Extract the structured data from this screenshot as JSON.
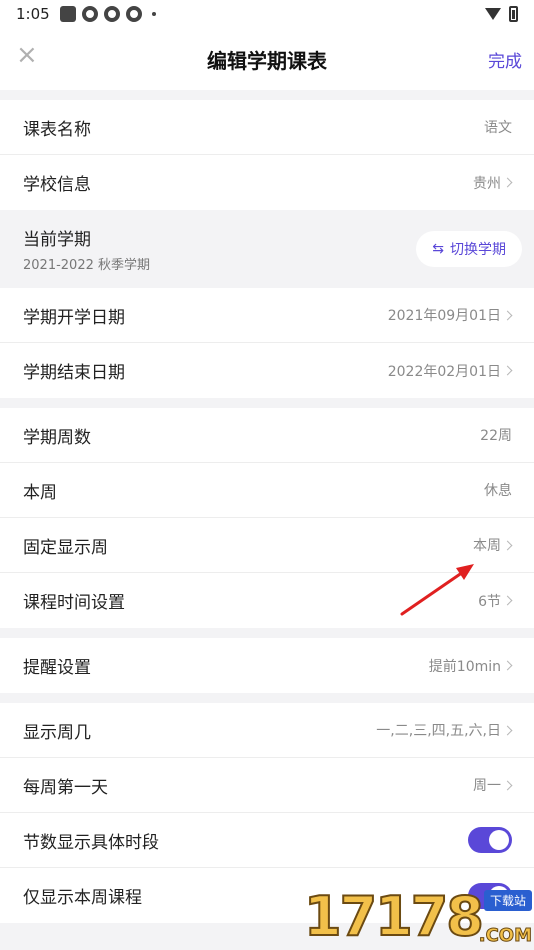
{
  "status_bar": {
    "time": "1:05"
  },
  "header": {
    "title": "编辑学期课表",
    "done_label": "完成"
  },
  "section1": [
    {
      "label": "课表名称",
      "value": "语文",
      "chevron": false
    },
    {
      "label": "学校信息",
      "value": "贵州",
      "chevron": true
    }
  ],
  "term": {
    "label": "当前学期",
    "sub": "2021-2022 秋季学期",
    "switch_label": "切换学期"
  },
  "section2": [
    {
      "label": "学期开学日期",
      "value": "2021年09月01日"
    },
    {
      "label": "学期结束日期",
      "value": "2022年02月01日"
    }
  ],
  "section3": [
    {
      "label": "学期周数",
      "value": "22周"
    },
    {
      "label": "本周",
      "value": "休息"
    },
    {
      "label": "固定显示周",
      "value": "本周"
    },
    {
      "label": "课程时间设置",
      "value": "6节"
    }
  ],
  "section4": [
    {
      "label": "提醒设置",
      "value": "提前10min"
    }
  ],
  "section5": [
    {
      "label": "显示周几",
      "value": "一,二,三,四,五,六,日"
    },
    {
      "label": "每周第一天",
      "value": "周一"
    },
    {
      "label": "节数显示具体时段",
      "toggle": true
    },
    {
      "label": "仅显示本周课程",
      "toggle": true
    }
  ],
  "watermark": {
    "number": "17178",
    "tag": "下载站",
    "suffix": ".COM"
  },
  "colors": {
    "accent": "#5a48d8",
    "annotation_arrow": "#e02020"
  }
}
